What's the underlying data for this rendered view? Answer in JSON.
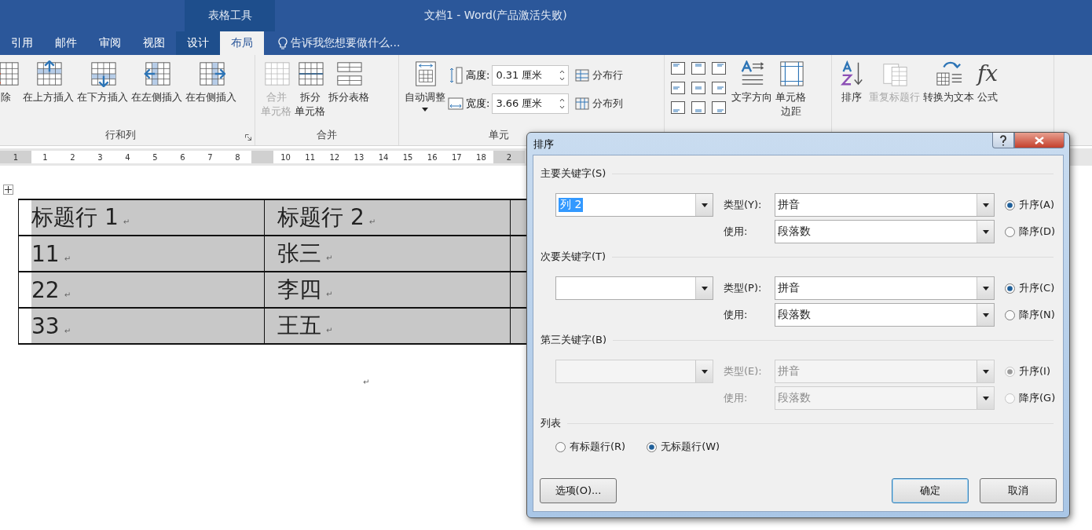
{
  "window": {
    "context_tab": "表格工具",
    "title": "文档1 - Word(产品激活失败)"
  },
  "tabs": [
    {
      "label": "引用",
      "selected": false
    },
    {
      "label": "邮件",
      "selected": false
    },
    {
      "label": "审阅",
      "selected": false
    },
    {
      "label": "视图",
      "selected": false
    },
    {
      "label": "设计",
      "selected": false
    },
    {
      "label": "布局",
      "selected": true
    }
  ],
  "tell_me": {
    "placeholder": "告诉我您想要做什么..."
  },
  "ribbon": {
    "groups": [
      {
        "label": "行和列",
        "launcher": true,
        "items": [
          {
            "kind": "large",
            "label": "除",
            "disabled": false
          },
          {
            "kind": "large",
            "label": "在上方插入",
            "disabled": false
          },
          {
            "kind": "large",
            "label": "在下方插入",
            "disabled": false
          },
          {
            "kind": "large",
            "label": "在左侧插入",
            "disabled": false
          },
          {
            "kind": "large",
            "label": "在右侧插入",
            "disabled": false
          }
        ]
      },
      {
        "label": "合并",
        "items": [
          {
            "kind": "large",
            "lines": [
              "合并",
              "单元格"
            ],
            "disabled": true
          },
          {
            "kind": "large",
            "lines": [
              "拆分",
              "单元格"
            ],
            "disabled": false
          },
          {
            "kind": "large",
            "label": "拆分表格",
            "disabled": false
          }
        ]
      },
      {
        "label": "单元",
        "items": [
          {
            "kind": "large",
            "label": "自动调整",
            "disabled": false
          },
          {
            "kind": "spin",
            "label": "高度:",
            "value": "0.31 厘米"
          },
          {
            "kind": "spin",
            "label": "宽度:",
            "value": "3.66 厘米"
          },
          {
            "kind": "small",
            "label": "分布行",
            "disabled": false
          },
          {
            "kind": "small",
            "label": "分布列",
            "disabled": false
          }
        ]
      },
      {
        "items": [
          {
            "kind": "align"
          },
          {
            "kind": "large",
            "label": "文字方向",
            "disabled": false
          },
          {
            "kind": "large",
            "lines": [
              "单元格",
              "边距"
            ],
            "disabled": false
          }
        ]
      },
      {
        "items": [
          {
            "kind": "large",
            "label": "排序",
            "disabled": false
          },
          {
            "kind": "large",
            "label": "重复标题行",
            "disabled": true
          },
          {
            "kind": "large",
            "label": "转换为文本",
            "disabled": false
          },
          {
            "kind": "large",
            "label": "公式",
            "icon_text": "fx",
            "disabled": false
          }
        ]
      }
    ]
  },
  "ruler": [
    {
      "kind": "margin",
      "labels": [
        "1"
      ]
    },
    {
      "kind": "text",
      "labels": [
        "1",
        "2",
        "3",
        "4",
        "5",
        "6",
        "7",
        "8"
      ]
    },
    {
      "kind": "margin"
    },
    {
      "kind": "text",
      "labels": [
        "10",
        "11",
        "12",
        "13",
        "14",
        "15",
        "16",
        "17",
        "18"
      ]
    },
    {
      "kind": "margin",
      "labels": [
        "2"
      ]
    }
  ],
  "table": {
    "para_mark": "↵",
    "rows": [
      [
        "标题行 1",
        "标题行 2",
        ""
      ],
      [
        "11",
        "张三",
        ""
      ],
      [
        "22",
        "李四",
        ""
      ],
      [
        "33",
        "王五",
        ""
      ]
    ]
  },
  "end_mark": "↵",
  "dialog": {
    "title": "排序",
    "sections": [
      {
        "label": "主要关键字(S)",
        "disabled": false,
        "key": {
          "value": "列 2",
          "text_selected": true
        },
        "type_label": "类型(Y):",
        "type_value": "拼音",
        "use_label": "使用:",
        "use_value": "段落数",
        "orders": [
          {
            "label": "升序(A)",
            "selected": true
          },
          {
            "label": "降序(D)",
            "selected": false
          }
        ]
      },
      {
        "label": "次要关键字(T)",
        "disabled": false,
        "type_label": "类型(P):",
        "type_value": "拼音",
        "use_label": "使用:",
        "use_value": "段落数",
        "orders": [
          {
            "label": "升序(C)",
            "selected": true
          },
          {
            "label": "降序(N)",
            "selected": false
          }
        ]
      },
      {
        "label": "第三关键字(B)",
        "disabled": true,
        "type_label": "类型(E):",
        "type_value": "拼音",
        "use_label": "使用:",
        "use_value": "段落数",
        "orders": [
          {
            "label": "升序(I)",
            "selected": true
          },
          {
            "label": "降序(G)",
            "selected": false
          }
        ]
      }
    ],
    "list": {
      "label": "列表",
      "options": [
        {
          "label": "有标题行(R)",
          "selected": false
        },
        {
          "label": "无标题行(W)",
          "selected": true
        }
      ]
    },
    "buttons": [
      {
        "label": "选项(O)...",
        "default": false
      },
      {
        "label": "确定",
        "default": true
      },
      {
        "label": "取消",
        "default": false
      }
    ]
  }
}
